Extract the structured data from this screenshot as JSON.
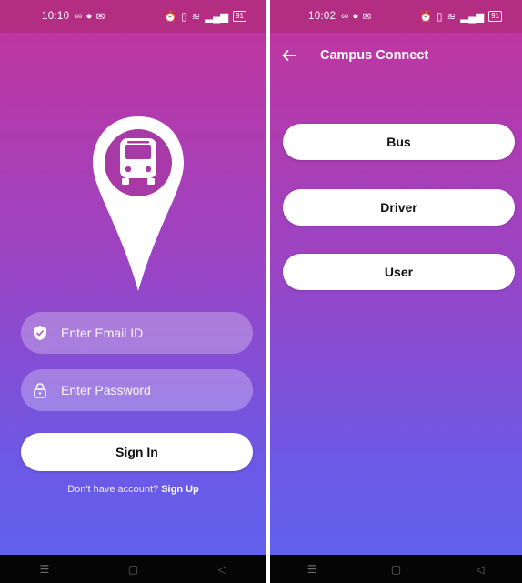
{
  "left_screen": {
    "status": {
      "time": "10:10",
      "battery": "91"
    },
    "logo_icon": "bus-location-pin-icon",
    "email": {
      "placeholder": "Enter Email ID",
      "icon": "shield-check-icon"
    },
    "password": {
      "placeholder": "Enter Password",
      "icon": "lock-icon"
    },
    "signin_label": "Sign In",
    "signup_prompt": "Don't have account?",
    "signup_link": "Sign Up"
  },
  "right_screen": {
    "status": {
      "time": "10:02",
      "battery": "91"
    },
    "title": "Campus Connect",
    "options": [
      "Bus",
      "Driver",
      "User"
    ]
  },
  "colors": {
    "gradient_top": "#c2349c",
    "gradient_bottom": "#5f63f0",
    "status_bar": "#b32e83",
    "button": "#ffffff",
    "nav_bar": "#050505"
  }
}
